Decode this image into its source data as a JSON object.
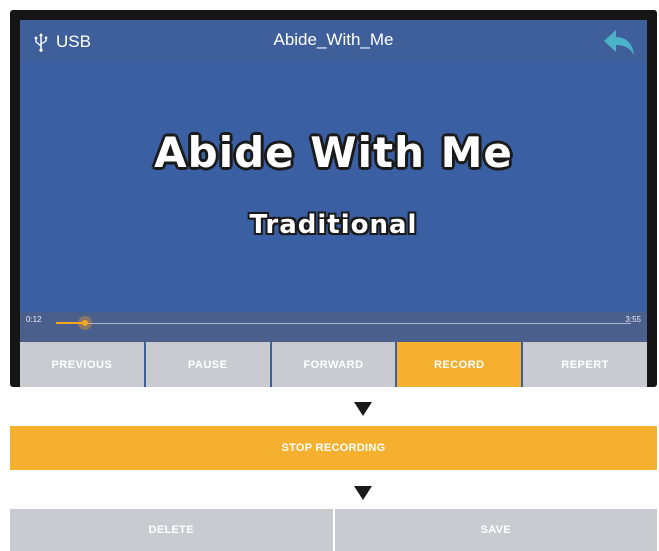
{
  "header": {
    "source_icon": "usb-icon",
    "source_label": "USB",
    "title": "Abide_With_Me",
    "back_icon": "back-arrow-icon"
  },
  "video": {
    "song_title": "Abide With Me",
    "song_artist": "Traditional"
  },
  "playback": {
    "current_time": "0:12",
    "total_time": "3:55",
    "progress_fraction": 0.051
  },
  "controls": [
    {
      "label": "PREVIOUS",
      "active": false
    },
    {
      "label": "PAUSE",
      "active": false
    },
    {
      "label": "FORWARD",
      "active": false
    },
    {
      "label": "RECORD",
      "active": true
    },
    {
      "label": "REPERT",
      "active": false
    }
  ],
  "flow": {
    "arrow_icon": "down-triangle-icon",
    "stop_recording_label": "STOP RECORDING",
    "delete_label": "DELETE",
    "save_label": "SAVE"
  },
  "colors": {
    "accent": "#f5b030",
    "screen_blue": "#3a5fa2",
    "button_gray": "#c9cbd0"
  }
}
